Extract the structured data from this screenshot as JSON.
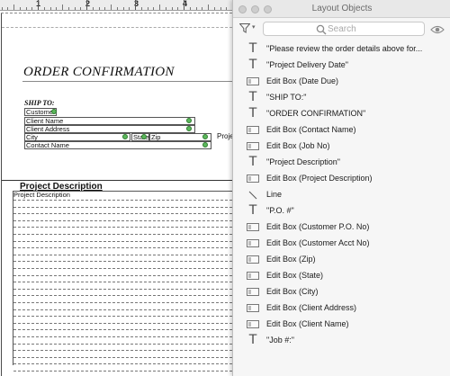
{
  "ruler": {
    "numbers": [
      "1",
      "2",
      "3",
      "4"
    ]
  },
  "layout": {
    "title": "ORDER CONFIRMATION",
    "ship_to": "SHIP TO:",
    "fields": {
      "customer": "Customer",
      "client_name": "Client Name",
      "client_address": "Client Address",
      "city": "City",
      "state": "State",
      "zip": "Zip",
      "contact_name": "Contact Name"
    },
    "project_fragment": "Proje",
    "project_heading": "Project Description",
    "project_box_label": "Project Description"
  },
  "panel": {
    "title": "Layout Objects",
    "search_placeholder": "Search",
    "filter_icon": "filter-icon",
    "visibility_icon": "eye-icon",
    "items": [
      {
        "type": "text",
        "icon": "text-object-icon",
        "label": "\"Please review the order details above for..."
      },
      {
        "type": "text",
        "icon": "text-object-icon",
        "label": "\"Project Delivery Date\""
      },
      {
        "type": "editbox",
        "icon": "edit-box-icon",
        "label": "Edit Box (Date Due)"
      },
      {
        "type": "text",
        "icon": "text-object-icon",
        "label": "\"SHIP TO:\""
      },
      {
        "type": "text",
        "icon": "text-object-icon",
        "label": "\"ORDER CONFIRMATION\""
      },
      {
        "type": "editbox",
        "icon": "edit-box-icon",
        "label": "Edit Box (Contact Name)"
      },
      {
        "type": "editbox",
        "icon": "edit-box-icon",
        "label": "Edit Box (Job No)"
      },
      {
        "type": "text",
        "icon": "text-object-icon",
        "label": "\"Project Description\""
      },
      {
        "type": "editbox",
        "icon": "edit-box-icon",
        "label": "Edit Box (Project Description)"
      },
      {
        "type": "line",
        "icon": "line-object-icon",
        "label": "Line"
      },
      {
        "type": "text",
        "icon": "text-object-icon",
        "label": "\"P.O. #\""
      },
      {
        "type": "editbox",
        "icon": "edit-box-icon",
        "label": "Edit Box (Customer P.O. No)"
      },
      {
        "type": "editbox",
        "icon": "edit-box-icon",
        "label": "Edit Box (Customer Acct No)"
      },
      {
        "type": "editbox",
        "icon": "edit-box-icon",
        "label": "Edit Box (Zip)"
      },
      {
        "type": "editbox",
        "icon": "edit-box-icon",
        "label": "Edit Box (State)"
      },
      {
        "type": "editbox",
        "icon": "edit-box-icon",
        "label": "Edit Box (City)"
      },
      {
        "type": "editbox",
        "icon": "edit-box-icon",
        "label": "Edit Box (Client Address)"
      },
      {
        "type": "editbox",
        "icon": "edit-box-icon",
        "label": "Edit Box (Client Name)"
      },
      {
        "type": "text",
        "icon": "text-object-icon",
        "label": "\"Job #:\""
      }
    ]
  }
}
